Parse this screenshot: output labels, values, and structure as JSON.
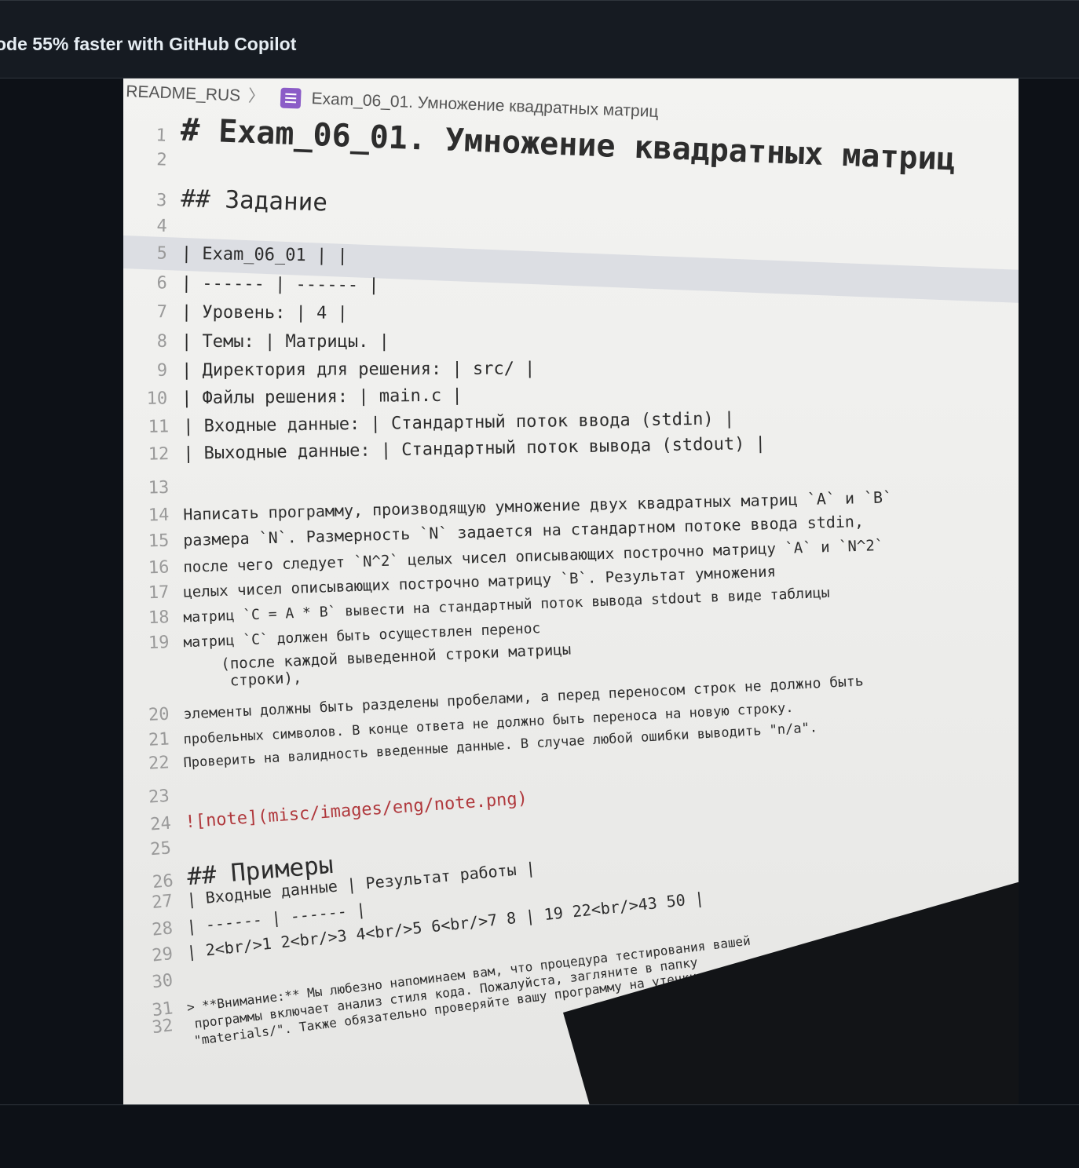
{
  "banner": {
    "text": "ode 55% faster with GitHub Copilot"
  },
  "breadcrumb": {
    "parent": "README_RUS",
    "separator": "〉",
    "file": "Exam_06_01. Умножение квадратных матриц"
  },
  "editor": {
    "lines": [
      {
        "n": "1",
        "text": "# Exam_06_01. Умножение квадратных матриц",
        "style": "h1"
      },
      {
        "n": "2",
        "text": "",
        "style": "normal"
      },
      {
        "n": "3",
        "text": "## Задание",
        "style": "h2"
      },
      {
        "n": "4",
        "text": "",
        "style": "normal"
      },
      {
        "n": "5",
        "text": "| Exam_06_01 | |",
        "style": "normal"
      },
      {
        "n": "6",
        "text": "| ------ | ------ |",
        "style": "normal"
      },
      {
        "n": "7",
        "text": "| Уровень: | 4 |",
        "style": "normal"
      },
      {
        "n": "8",
        "text": "| Темы: | Матрицы. |",
        "style": "normal"
      },
      {
        "n": "9",
        "text": "| Директория для решения: | src/ |",
        "style": "normal"
      },
      {
        "n": "10",
        "text": "| Файлы решения: | main.c |",
        "style": "normal"
      },
      {
        "n": "11",
        "text": "| Входные данные: | Стандартный поток ввода (stdin) |",
        "style": "normal"
      },
      {
        "n": "12",
        "text": "| Выходные данные: | Стандартный поток вывода (stdout) |",
        "style": "normal"
      },
      {
        "n": "13",
        "text": "",
        "style": "normal"
      },
      {
        "n": "14",
        "text": "Написать программу, производящую умножение двух квадратных матриц `A` и `B`",
        "style": "normal"
      },
      {
        "n": "15",
        "text": "размера `N`. Размерность `N` задается на стандартном потоке ввода stdin,",
        "style": "normal"
      },
      {
        "n": "16",
        "text": "после чего следует `N^2` целых чисел описывающих построчно матрицу `A` и `N^2`",
        "style": "normal"
      },
      {
        "n": "17",
        "text": "целых чисел описывающих построчно матрицу `B`. Результат умножения",
        "style": "normal"
      },
      {
        "n": "18",
        "text": "матриц `C = A * B` вывести на стандартный поток вывода stdout в виде таблицы",
        "style": "normal"
      },
      {
        "n": "19",
        "text": "матриц `C` должен быть осуществлен перенос",
        "style": "normal"
      },
      {
        "n": "",
        "text": "(после каждой выведенной строки матрицы",
        "style": "normal"
      },
      {
        "n": "",
        "text": "    строки),",
        "style": "normal"
      },
      {
        "n": "20",
        "text": "элементы должны быть разделены пробелами, а перед переносом строк не должно быть",
        "style": "normal"
      },
      {
        "n": "21",
        "text": "пробельных символов. В конце ответа не должно быть переноса на новую строку.",
        "style": "normal"
      },
      {
        "n": "22",
        "text": "Проверить на валидность введенные данные. В случае любой ошибки выводить \"n/a\".",
        "style": "normal"
      },
      {
        "n": "23",
        "text": "",
        "style": "normal"
      },
      {
        "n": "24",
        "text": "![note](misc/images/eng/note.png)",
        "style": "link"
      },
      {
        "n": "25",
        "text": "",
        "style": "normal"
      },
      {
        "n": "26",
        "text": "## Примеры",
        "style": "h2"
      },
      {
        "n": "27",
        "text": "| Входные данные | Результат работы |",
        "style": "normal"
      },
      {
        "n": "28",
        "text": "| ------ | ------ |",
        "style": "normal"
      },
      {
        "n": "29",
        "text": "| 2<br/>1 2<br/>3 4<br/>5 6<br/>7 8 | 19 22<br/>43 50 |",
        "style": "normal"
      },
      {
        "n": "30",
        "text": "",
        "style": "normal"
      },
      {
        "n": "31",
        "text": "> **Внимание:** Мы любезно напоминаем вам, что процедура тестирования вашей",
        "style": "normal"
      },
      {
        "n": "32",
        "text": "  программы включает анализ стиля кода. Пожалуйста, загляните в папку",
        "style": "normal"
      },
      {
        "n": "",
        "text": "  \"materials/\". Также обязательно проверяйте вашу программу на утечки памяти!",
        "style": "normal"
      }
    ]
  }
}
